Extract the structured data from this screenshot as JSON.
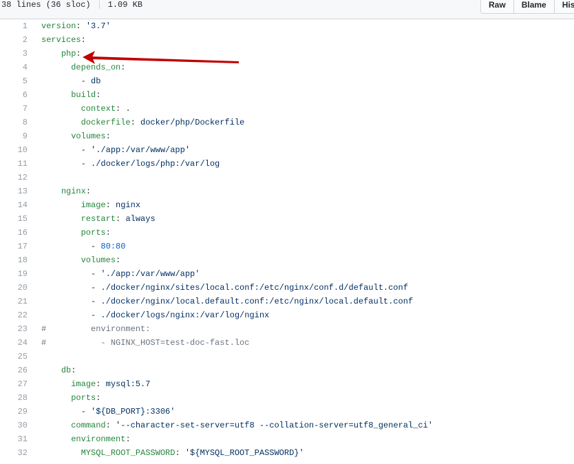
{
  "file_header": {
    "lines_info": "38 lines (36 sloc)",
    "size": "1.09 KB",
    "buttons": [
      "Raw",
      "Blame",
      "Hist"
    ]
  },
  "colors": {
    "key": "#22863a",
    "string": "#032f62",
    "number": "#005cc5",
    "comment": "#6a737d",
    "plain": "#24292e",
    "line_number": "#959da5",
    "annotation_arrow": "#c00000"
  },
  "annotation": {
    "icon": "red-arrow-pointing-to-php"
  },
  "lines": [
    {
      "n": "1",
      "tokens": [
        {
          "t": "key",
          "v": "version"
        },
        {
          "t": "plain",
          "v": ": "
        },
        {
          "t": "str",
          "v": "'3.7'"
        }
      ]
    },
    {
      "n": "2",
      "tokens": [
        {
          "t": "key",
          "v": "services"
        },
        {
          "t": "plain",
          "v": ":"
        }
      ]
    },
    {
      "n": "3",
      "tokens": [
        {
          "t": "plain",
          "v": "    "
        },
        {
          "t": "key",
          "v": "php"
        },
        {
          "t": "plain",
          "v": ":"
        }
      ]
    },
    {
      "n": "4",
      "tokens": [
        {
          "t": "plain",
          "v": "      "
        },
        {
          "t": "key",
          "v": "depends_on"
        },
        {
          "t": "plain",
          "v": ":"
        }
      ]
    },
    {
      "n": "5",
      "tokens": [
        {
          "t": "plain",
          "v": "        - "
        },
        {
          "t": "str",
          "v": "db"
        }
      ]
    },
    {
      "n": "6",
      "tokens": [
        {
          "t": "plain",
          "v": "      "
        },
        {
          "t": "key",
          "v": "build"
        },
        {
          "t": "plain",
          "v": ":"
        }
      ]
    },
    {
      "n": "7",
      "tokens": [
        {
          "t": "plain",
          "v": "        "
        },
        {
          "t": "key",
          "v": "context"
        },
        {
          "t": "plain",
          "v": ": "
        },
        {
          "t": "str",
          "v": "."
        }
      ]
    },
    {
      "n": "8",
      "tokens": [
        {
          "t": "plain",
          "v": "        "
        },
        {
          "t": "key",
          "v": "dockerfile"
        },
        {
          "t": "plain",
          "v": ": "
        },
        {
          "t": "str",
          "v": "docker/php/Dockerfile"
        }
      ]
    },
    {
      "n": "9",
      "tokens": [
        {
          "t": "plain",
          "v": "      "
        },
        {
          "t": "key",
          "v": "volumes"
        },
        {
          "t": "plain",
          "v": ":"
        }
      ]
    },
    {
      "n": "10",
      "tokens": [
        {
          "t": "plain",
          "v": "        - "
        },
        {
          "t": "str",
          "v": "'./app:/var/www/app'"
        }
      ]
    },
    {
      "n": "11",
      "tokens": [
        {
          "t": "plain",
          "v": "        - "
        },
        {
          "t": "str",
          "v": "./docker/logs/php:/var/log"
        }
      ]
    },
    {
      "n": "12",
      "tokens": []
    },
    {
      "n": "13",
      "tokens": [
        {
          "t": "plain",
          "v": "    "
        },
        {
          "t": "key",
          "v": "nginx"
        },
        {
          "t": "plain",
          "v": ":"
        }
      ]
    },
    {
      "n": "14",
      "tokens": [
        {
          "t": "plain",
          "v": "        "
        },
        {
          "t": "key",
          "v": "image"
        },
        {
          "t": "plain",
          "v": ": "
        },
        {
          "t": "str",
          "v": "nginx"
        }
      ]
    },
    {
      "n": "15",
      "tokens": [
        {
          "t": "plain",
          "v": "        "
        },
        {
          "t": "key",
          "v": "restart"
        },
        {
          "t": "plain",
          "v": ": "
        },
        {
          "t": "str",
          "v": "always"
        }
      ]
    },
    {
      "n": "16",
      "tokens": [
        {
          "t": "plain",
          "v": "        "
        },
        {
          "t": "key",
          "v": "ports"
        },
        {
          "t": "plain",
          "v": ":"
        }
      ]
    },
    {
      "n": "17",
      "tokens": [
        {
          "t": "plain",
          "v": "          - "
        },
        {
          "t": "num",
          "v": "80:80"
        }
      ]
    },
    {
      "n": "18",
      "tokens": [
        {
          "t": "plain",
          "v": "        "
        },
        {
          "t": "key",
          "v": "volumes"
        },
        {
          "t": "plain",
          "v": ":"
        }
      ]
    },
    {
      "n": "19",
      "tokens": [
        {
          "t": "plain",
          "v": "          - "
        },
        {
          "t": "str",
          "v": "'./app:/var/www/app'"
        }
      ]
    },
    {
      "n": "20",
      "tokens": [
        {
          "t": "plain",
          "v": "          - "
        },
        {
          "t": "str",
          "v": "./docker/nginx/sites/local.conf:/etc/nginx/conf.d/default.conf"
        }
      ]
    },
    {
      "n": "21",
      "tokens": [
        {
          "t": "plain",
          "v": "          - "
        },
        {
          "t": "str",
          "v": "./docker/nginx/local.default.conf:/etc/nginx/local.default.conf"
        }
      ]
    },
    {
      "n": "22",
      "tokens": [
        {
          "t": "plain",
          "v": "          - "
        },
        {
          "t": "str",
          "v": "./docker/logs/nginx:/var/log/nginx"
        }
      ]
    },
    {
      "n": "23",
      "tokens": [
        {
          "t": "cmt",
          "v": "#         environment:"
        }
      ]
    },
    {
      "n": "24",
      "tokens": [
        {
          "t": "cmt",
          "v": "#           - NGINX_HOST=test-doc-fast.loc"
        }
      ]
    },
    {
      "n": "25",
      "tokens": []
    },
    {
      "n": "26",
      "tokens": [
        {
          "t": "plain",
          "v": "    "
        },
        {
          "t": "key",
          "v": "db"
        },
        {
          "t": "plain",
          "v": ":"
        }
      ]
    },
    {
      "n": "27",
      "tokens": [
        {
          "t": "plain",
          "v": "      "
        },
        {
          "t": "key",
          "v": "image"
        },
        {
          "t": "plain",
          "v": ": "
        },
        {
          "t": "str",
          "v": "mysql:5.7"
        }
      ]
    },
    {
      "n": "28",
      "tokens": [
        {
          "t": "plain",
          "v": "      "
        },
        {
          "t": "key",
          "v": "ports"
        },
        {
          "t": "plain",
          "v": ":"
        }
      ]
    },
    {
      "n": "29",
      "tokens": [
        {
          "t": "plain",
          "v": "        - "
        },
        {
          "t": "str",
          "v": "'${DB_PORT}:3306'"
        }
      ]
    },
    {
      "n": "30",
      "tokens": [
        {
          "t": "plain",
          "v": "      "
        },
        {
          "t": "key",
          "v": "command"
        },
        {
          "t": "plain",
          "v": ": "
        },
        {
          "t": "str",
          "v": "'--character-set-server=utf8 --collation-server=utf8_general_ci'"
        }
      ]
    },
    {
      "n": "31",
      "tokens": [
        {
          "t": "plain",
          "v": "      "
        },
        {
          "t": "key",
          "v": "environment"
        },
        {
          "t": "plain",
          "v": ":"
        }
      ]
    },
    {
      "n": "32",
      "tokens": [
        {
          "t": "plain",
          "v": "        "
        },
        {
          "t": "key",
          "v": "MYSQL_ROOT_PASSWORD"
        },
        {
          "t": "plain",
          "v": ": "
        },
        {
          "t": "str",
          "v": "'${MYSQL_ROOT_PASSWORD}'"
        }
      ]
    }
  ]
}
